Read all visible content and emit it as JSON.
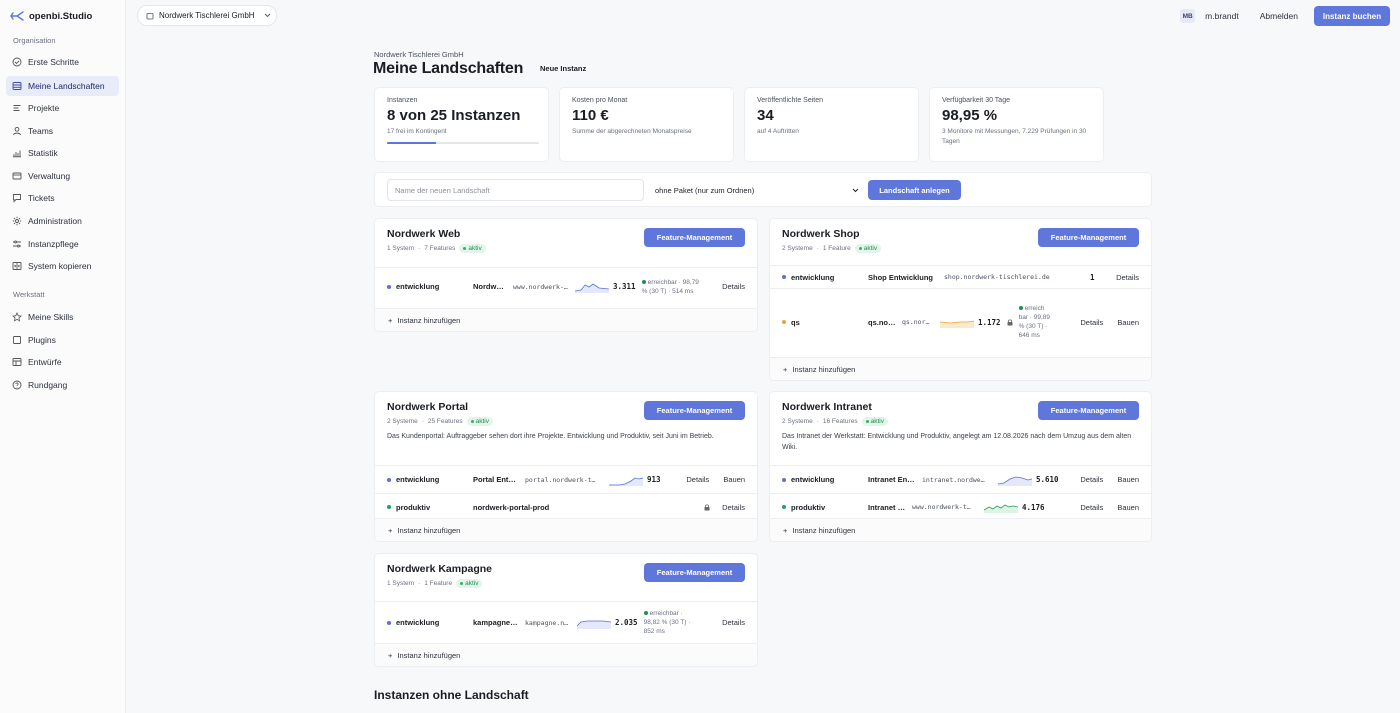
{
  "brand": {
    "name": "openbi.Studio"
  },
  "sidebar": {
    "section_org": "Organisation",
    "org_items": [
      {
        "label": "Erste Schritte",
        "icon": "check-circle-icon"
      },
      {
        "label": "Meine Landschaften",
        "icon": "layers-icon",
        "active": true
      },
      {
        "label": "Projekte",
        "icon": "list-icon"
      },
      {
        "label": "Teams",
        "icon": "user-icon"
      },
      {
        "label": "Statistik",
        "icon": "bar-chart-icon"
      },
      {
        "label": "Verwaltung",
        "icon": "credit-card-icon"
      },
      {
        "label": "Tickets",
        "icon": "message-icon"
      },
      {
        "label": "Administration",
        "icon": "gear-icon"
      },
      {
        "label": "Instanzpflege",
        "icon": "sliders-icon"
      },
      {
        "label": "System kopieren",
        "icon": "copy-icon"
      }
    ],
    "section_workshop": "Werkstatt",
    "workshop_items": [
      {
        "label": "Meine Skills",
        "icon": "star-icon"
      },
      {
        "label": "Plugins",
        "icon": "square-icon"
      },
      {
        "label": "Entwürfe",
        "icon": "table-icon"
      },
      {
        "label": "Rundgang",
        "icon": "help-circle-icon"
      }
    ]
  },
  "topbar": {
    "org_name": "Nordwerk Tischlerei GmbH",
    "avatar": "MB",
    "username": "m.brandt",
    "logout": "Abmelden",
    "book_label": "Instanz buchen"
  },
  "header": {
    "subtitle": "Nordwerk Tischlerei GmbH",
    "title": "Meine Landschaften",
    "new_instance": "Neue Instanz"
  },
  "stats": [
    {
      "label": "Instanzen",
      "value": "8 von 25 Instanzen",
      "note": "17 frei im Kontingent",
      "progress": 0.32
    },
    {
      "label": "Kosten pro Monat",
      "value": "110 €",
      "note": "Summe der abgerechneten Monatspreise"
    },
    {
      "label": "Veröffentlichte Seiten",
      "value": "34",
      "note": "auf 4 Auftritten"
    },
    {
      "label": "Verfügbarkeit 30 Tage",
      "value": "98,95 %",
      "note": "3 Monitore mit Messungen, 7.229 Prüfungen in 30 Tagen"
    }
  ],
  "create": {
    "placeholder": "Name der neuen Landschaft",
    "package": "ohne Paket (nur zum Ordnen)",
    "button": "Landschaft anlegen"
  },
  "colors": {
    "accent": "#5f76db",
    "dev": "#5b6fd6",
    "qs": "#e8a43a",
    "prod": "#22a060"
  },
  "landscapes": {
    "web": {
      "title": "Nordwerk Web",
      "systems": "1 System",
      "features": "7 Features",
      "status": "aktiv",
      "feature_btn": "Feature-Management",
      "instances": [
        {
          "env": "entwicklung",
          "name": "Nordw…",
          "url": "www.nordwerk-…",
          "value": "3.311",
          "avail": "erreichbar · 98,79 % (30 T) · 514 ms",
          "details": "Details"
        }
      ],
      "add": "Instanz hinzufügen"
    },
    "shop": {
      "title": "Nordwerk Shop",
      "systems": "2 Systeme",
      "features": "1 Feature",
      "status": "aktiv",
      "feature_btn": "Feature-Management",
      "instances": [
        {
          "env": "entwicklung",
          "name": "Shop Entwicklung",
          "url": "shop.nordwerk-tischlerei.de",
          "value": "1",
          "details": "Details"
        },
        {
          "env": "qs",
          "name": "qs.no…",
          "url": "qs.nor…",
          "value": "1.172",
          "avail": "erreich bar · 99,89 % (30 T) · 646 ms",
          "details": "Details",
          "build": "Bauen"
        }
      ],
      "add": "Instanz hinzufügen"
    },
    "portal": {
      "title": "Nordwerk Portal",
      "systems": "2 Systeme",
      "features": "25 Features",
      "status": "aktiv",
      "feature_btn": "Feature-Management",
      "desc": "Das Kundenportal: Auftraggeber sehen dort ihre Projekte. Entwicklung und Produktiv, seit Juni im Betrieb.",
      "instances": [
        {
          "env": "entwicklung",
          "name": "Portal Ent…",
          "url": "portal.nordwerk-t…",
          "value": "913",
          "details": "Details",
          "build": "Bauen"
        },
        {
          "env": "produktiv",
          "name": "nordwerk-portal-prod",
          "details": "Details"
        }
      ],
      "add": "Instanz hinzufügen"
    },
    "intranet": {
      "title": "Nordwerk Intranet",
      "systems": "2 Systeme",
      "features": "16 Features",
      "status": "aktiv",
      "feature_btn": "Feature-Management",
      "desc": "Das Intranet der Werkstatt: Entwicklung und Produktiv, angelegt am 12.08.2026 nach dem Umzug aus dem alten Wiki.",
      "instances": [
        {
          "env": "entwicklung",
          "name": "Intranet En…",
          "url": "intranet.nordwe…",
          "value": "5.610",
          "details": "Details",
          "build": "Bauen"
        },
        {
          "env": "produktiv",
          "name": "Intranet …",
          "url": "www.nordwerk-t…",
          "value": "4.176",
          "details": "Details",
          "build": "Bauen"
        }
      ],
      "add": "Instanz hinzufügen"
    },
    "kampagne": {
      "title": "Nordwerk Kampagne",
      "systems": "1 System",
      "features": "1 Feature",
      "status": "aktiv",
      "feature_btn": "Feature-Management",
      "instances": [
        {
          "env": "entwicklung",
          "name": "kampagne…",
          "url": "kampagne.n…",
          "value": "2.035",
          "avail": "erreichbar · 98,82 % (30 T) · 852 ms",
          "details": "Details"
        }
      ],
      "add": "Instanz hinzufügen"
    }
  },
  "orphans_title": "Instanzen ohne Landschaft"
}
